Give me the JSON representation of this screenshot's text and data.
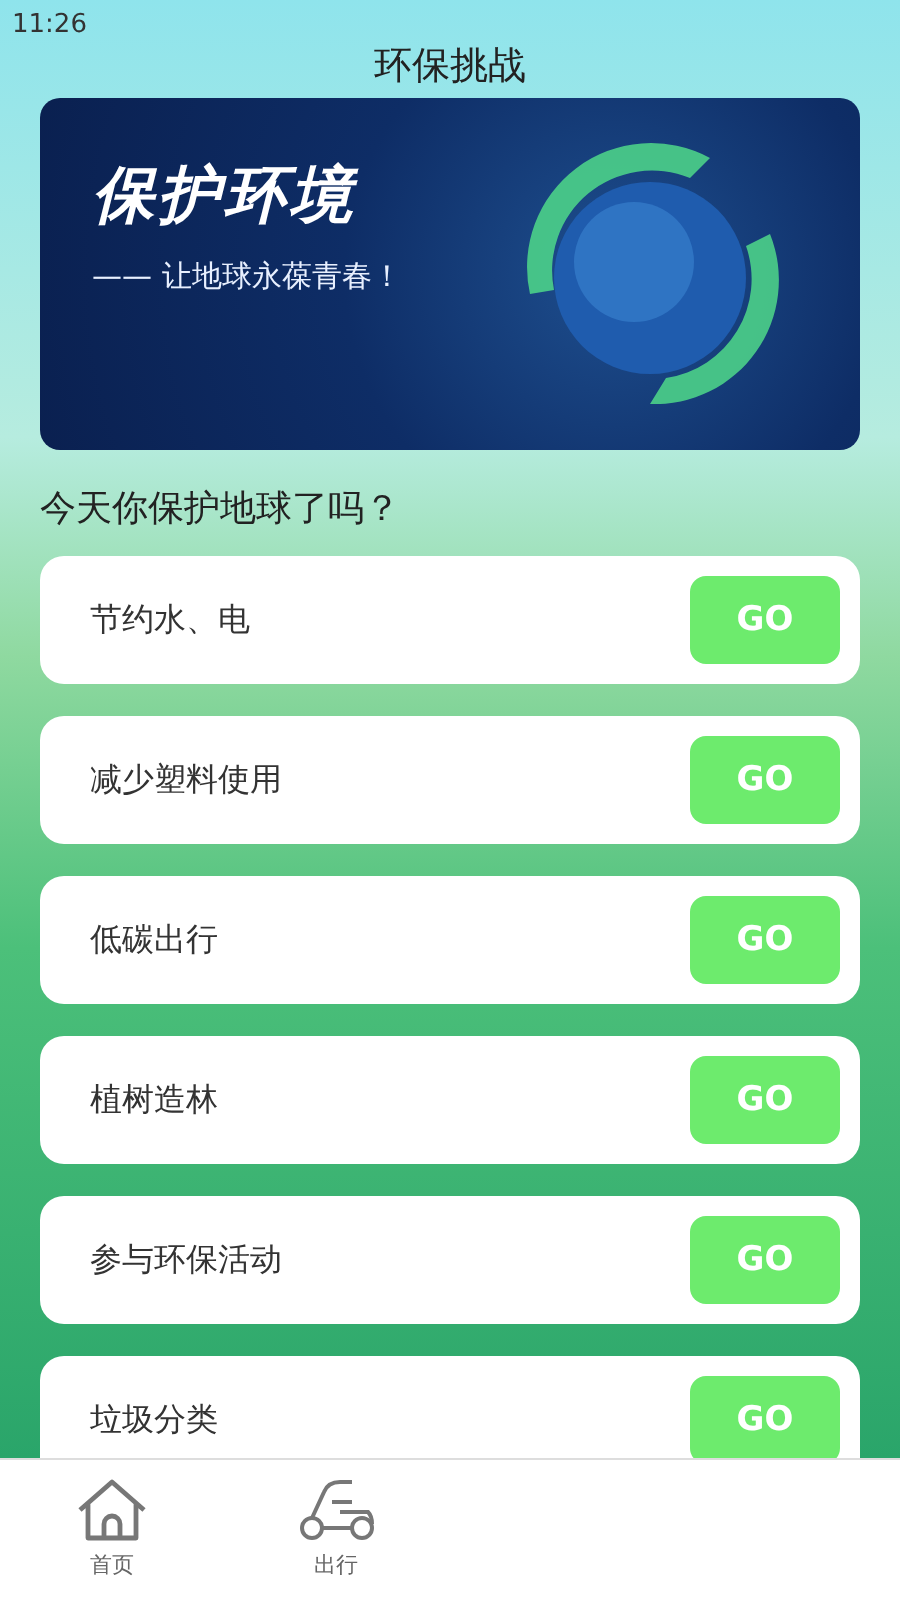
{
  "status_bar": {
    "time": "11:26"
  },
  "header": {
    "title": "环保挑战"
  },
  "banner": {
    "headline": "保护环境",
    "tagline": "—— 让地球永葆青春！"
  },
  "question": "今天你保护地球了吗？",
  "tasks": [
    {
      "label": "节约水、电",
      "button": "GO"
    },
    {
      "label": "减少塑料使用",
      "button": "GO"
    },
    {
      "label": "低碳出行",
      "button": "GO"
    },
    {
      "label": "植树造林",
      "button": "GO"
    },
    {
      "label": "参与环保活动",
      "button": "GO"
    },
    {
      "label": "垃圾分类",
      "button": "GO"
    }
  ],
  "tab_bar": [
    {
      "kind": "home",
      "label": "首页"
    },
    {
      "kind": "scooter",
      "label": "出行"
    }
  ]
}
